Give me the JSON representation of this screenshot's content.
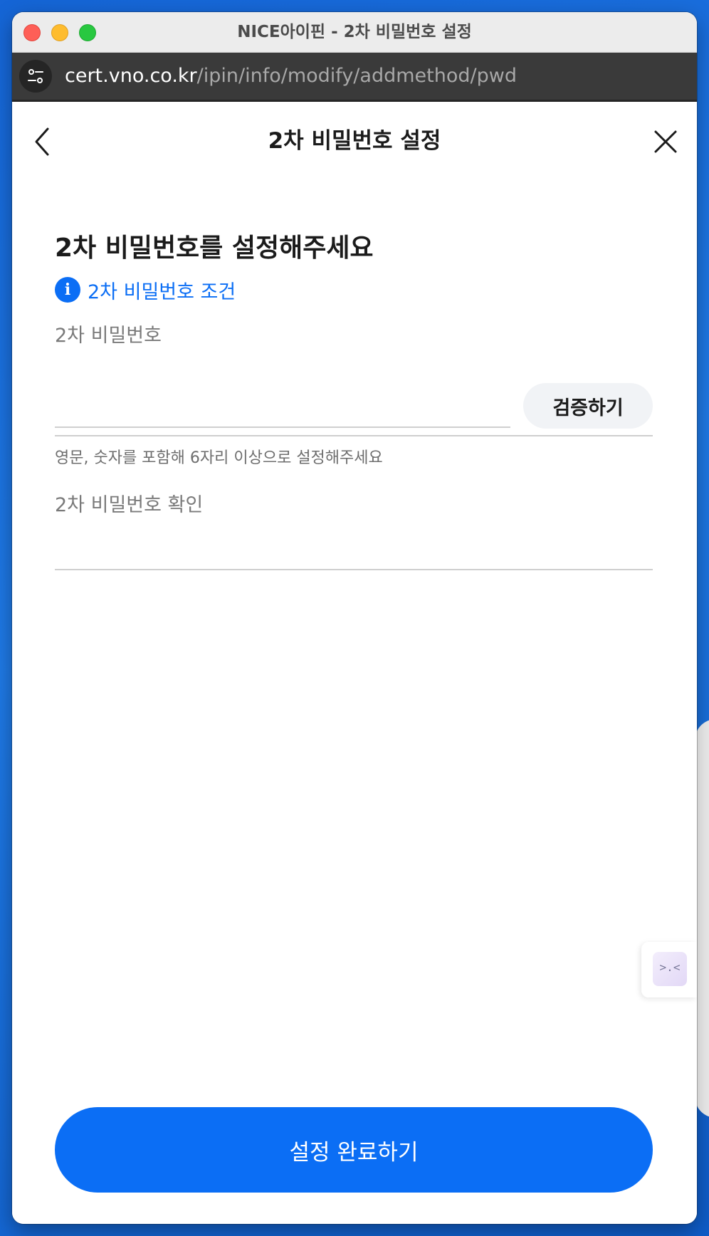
{
  "window": {
    "title": "NICE아이핀 - 2차 비밀번호 설정"
  },
  "urlbar": {
    "icon": "site-settings-icon",
    "host": "cert.vno.co.kr",
    "path": "/ipin/info/modify/addmethod/pwd"
  },
  "header": {
    "title": "2차 비밀번호 설정",
    "back_icon": "chevron-left-icon",
    "close_icon": "close-icon"
  },
  "main": {
    "heading": "2차 비밀번호를 설정해주세요",
    "info_icon_glyph": "i",
    "info_link": "2차 비밀번호 조건",
    "password_field": {
      "label": "2차 비밀번호",
      "value": "",
      "placeholder": ""
    },
    "verify_button": "검증하기",
    "helper": "영문, 숫자를 포함해 6자리 이상으로 설정해주세요",
    "confirm_field": {
      "label": "2차 비밀번호 확인",
      "value": "",
      "placeholder": ""
    },
    "floating_helper_glyph": ">.<",
    "submit_button": "설정 완료하기"
  },
  "colors": {
    "accent": "#0b6ef5",
    "text_primary": "#1b1b1b",
    "text_secondary": "#7a7a7a",
    "divider": "#cfcfcf",
    "secondary_button_bg": "#f1f3f6"
  }
}
